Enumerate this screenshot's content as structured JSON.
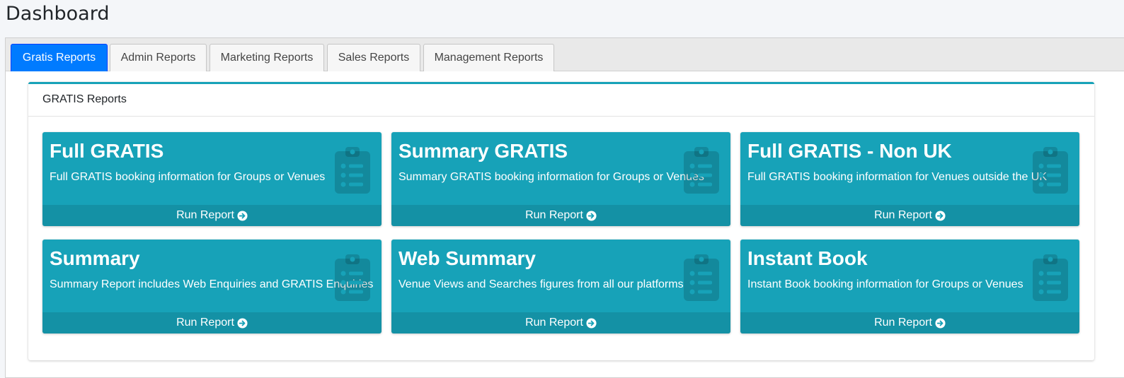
{
  "page": {
    "title": "Dashboard"
  },
  "tabs": [
    {
      "label": "Gratis Reports",
      "active": true
    },
    {
      "label": "Admin Reports",
      "active": false
    },
    {
      "label": "Marketing Reports",
      "active": false
    },
    {
      "label": "Sales Reports",
      "active": false
    },
    {
      "label": "Management Reports",
      "active": false
    }
  ],
  "panel": {
    "header": "GRATIS Reports",
    "boxes": [
      {
        "title": "Full GRATIS",
        "description": "Full GRATIS booking information for Groups or Venues",
        "link": "Run Report",
        "icon": "clipboard-list-icon"
      },
      {
        "title": "Summary GRATIS",
        "description": "Summary GRATIS booking information for Groups or Venues",
        "link": "Run Report",
        "icon": "clipboard-list-icon"
      },
      {
        "title": "Full GRATIS - Non UK",
        "description": "Full GRATIS booking information for Venues outside the UK",
        "link": "Run Report",
        "icon": "clipboard-list-icon"
      },
      {
        "title": "Summary",
        "description": "Summary Report includes Web Enquiries and GRATIS Enquiries",
        "link": "Run Report",
        "icon": "clipboard-list-icon"
      },
      {
        "title": "Web Summary",
        "description": "Venue Views and Searches figures from all our platforms",
        "link": "Run Report",
        "icon": "clipboard-list-icon"
      },
      {
        "title": "Instant Book",
        "description": "Instant Book booking information for Groups or Venues",
        "link": "Run Report",
        "icon": "clipboard-list-icon"
      }
    ]
  },
  "colors": {
    "info": "#17a2b8",
    "active_tab": "#007bff",
    "page_bg": "#f4f6f9"
  }
}
